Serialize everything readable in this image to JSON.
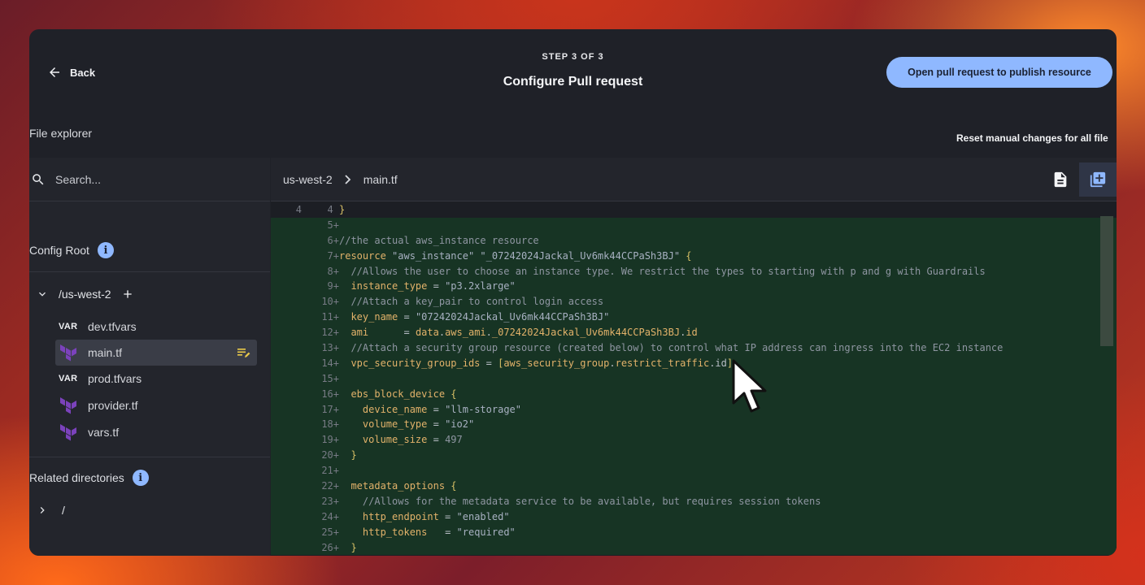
{
  "header": {
    "back_label": "Back",
    "step_label": "STEP 3 OF 3",
    "title": "Configure Pull request",
    "publish_button": "Open pull request to publish resource"
  },
  "file_explorer": {
    "label": "File explorer",
    "reset_link": "Reset manual changes for all file",
    "search_placeholder": "Search...",
    "config_root_label": "Config Root",
    "folder": "/us-west-2",
    "files": [
      {
        "name": "dev.tfvars",
        "icon": "var-badge",
        "badge": "VAR"
      },
      {
        "name": "main.tf",
        "icon": "terraform-icon",
        "selected": true
      },
      {
        "name": "prod.tfvars",
        "icon": "var-badge",
        "badge": "VAR"
      },
      {
        "name": "provider.tf",
        "icon": "terraform-icon"
      },
      {
        "name": "vars.tf",
        "icon": "terraform-icon"
      }
    ],
    "related_label": "Related directories",
    "related_root": "/"
  },
  "editor": {
    "breadcrumb": [
      "us-west-2",
      "main.tf"
    ],
    "lines": [
      {
        "old": "4",
        "new": "4",
        "mark": " ",
        "added": false,
        "html": "<span class=\"p\">}</span>"
      },
      {
        "old": "",
        "new": "5",
        "mark": "+",
        "added": true,
        "html": ""
      },
      {
        "old": "",
        "new": "6",
        "mark": "+",
        "added": true,
        "html": "<span class=\"c\">//the actual aws_instance resource</span>"
      },
      {
        "old": "",
        "new": "7",
        "mark": "+",
        "added": true,
        "html": "<span class=\"k\">resource</span> <span class=\"s\">\"aws_instance\"</span> <span class=\"s\">\"_07242024Jackal_Uv6mk44CCPaSh3BJ\"</span> <span class=\"p\">{</span>"
      },
      {
        "old": "",
        "new": "8",
        "mark": "+",
        "added": true,
        "html": "  <span class=\"c\">//Allows the user to choose an instance type. We restrict the types to starting with p and g with Guardrails</span>"
      },
      {
        "old": "",
        "new": "9",
        "mark": "+",
        "added": true,
        "html": "  <span class=\"k\">instance_type</span> = <span class=\"s\">\"p3.2xlarge\"</span>"
      },
      {
        "old": "",
        "new": "10",
        "mark": "+",
        "added": true,
        "html": "  <span class=\"c\">//Attach a key_pair to control login access</span>"
      },
      {
        "old": "",
        "new": "11",
        "mark": "+",
        "added": true,
        "html": "  <span class=\"k\">key_name</span> = <span class=\"s\">\"07242024Jackal_Uv6mk44CCPaSh3BJ\"</span>"
      },
      {
        "old": "",
        "new": "12",
        "mark": "+",
        "added": true,
        "html": "  <span class=\"k\">ami</span>      = <span class=\"k\">data</span>.<span class=\"k\">aws_ami</span>.<span class=\"k\">_07242024Jackal_Uv6mk44CCPaSh3BJ</span>.<span class=\"k\">id</span>"
      },
      {
        "old": "",
        "new": "13",
        "mark": "+",
        "added": true,
        "html": "  <span class=\"c\">//Attach a security group resource (created below) to control what IP address can ingress into the EC2 instance</span>"
      },
      {
        "old": "",
        "new": "14",
        "mark": "+",
        "added": true,
        "html": "  <span class=\"k\">vpc_security_group_ids</span> = <span class=\"p\">[</span><span class=\"k\">aws_security_group</span>.<span class=\"k\">restrict_traffic</span>.id<span class=\"p\">]</span>"
      },
      {
        "old": "",
        "new": "15",
        "mark": "+",
        "added": true,
        "html": ""
      },
      {
        "old": "",
        "new": "16",
        "mark": "+",
        "added": true,
        "html": "  <span class=\"k\">ebs_block_device</span> <span class=\"p\">{</span>"
      },
      {
        "old": "",
        "new": "17",
        "mark": "+",
        "added": true,
        "html": "    <span class=\"k\">device_name</span> = <span class=\"s\">\"llm-storage\"</span>"
      },
      {
        "old": "",
        "new": "18",
        "mark": "+",
        "added": true,
        "html": "    <span class=\"k\">volume_type</span> = <span class=\"s\">\"io2\"</span>"
      },
      {
        "old": "",
        "new": "19",
        "mark": "+",
        "added": true,
        "html": "    <span class=\"k\">volume_size</span> = <span class=\"c\">497</span>"
      },
      {
        "old": "",
        "new": "20",
        "mark": "+",
        "added": true,
        "html": "  <span class=\"p\">}</span>"
      },
      {
        "old": "",
        "new": "21",
        "mark": "+",
        "added": true,
        "html": ""
      },
      {
        "old": "",
        "new": "22",
        "mark": "+",
        "added": true,
        "html": "  <span class=\"k\">metadata_options</span> <span class=\"p\">{</span>"
      },
      {
        "old": "",
        "new": "23",
        "mark": "+",
        "added": true,
        "html": "    <span class=\"c\">//Allows for the metadata service to be available, but requires session tokens</span>"
      },
      {
        "old": "",
        "new": "24",
        "mark": "+",
        "added": true,
        "html": "    <span class=\"k\">http_endpoint</span> = <span class=\"s\">\"enabled\"</span>"
      },
      {
        "old": "",
        "new": "25",
        "mark": "+",
        "added": true,
        "html": "    <span class=\"k\">http_tokens</span>   = <span class=\"s\">\"required\"</span>"
      },
      {
        "old": "",
        "new": "26",
        "mark": "+",
        "added": true,
        "html": "  <span class=\"p\">}</span>"
      }
    ]
  },
  "colors": {
    "accent": "#8fb8ff",
    "added_line_bg": "#173424",
    "window_bg": "#1f2128",
    "terraform_purple": "#7b42bc"
  }
}
